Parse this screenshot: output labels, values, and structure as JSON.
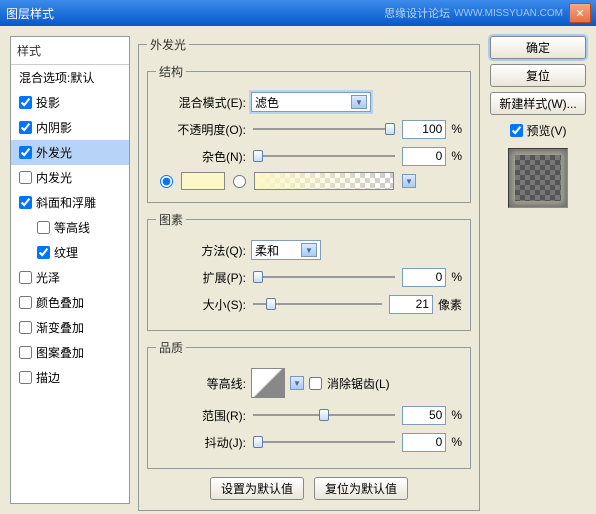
{
  "title": "图层样式",
  "brand": "思缘设计论坛",
  "url": "WWW.MISSYUAN.COM",
  "styles_title": "样式",
  "blend_options": "混合选项:默认",
  "styles": {
    "drop_shadow": "投影",
    "inner_shadow": "内阴影",
    "outer_glow": "外发光",
    "inner_glow": "内发光",
    "bevel": "斜面和浮雕",
    "contour": "等高线",
    "texture": "纹理",
    "satin": "光泽",
    "color_overlay": "颜色叠加",
    "gradient_overlay": "渐变叠加",
    "pattern_overlay": "图案叠加",
    "stroke": "描边"
  },
  "panel": {
    "title": "外发光",
    "structure": "结构",
    "blend_mode_label": "混合模式(E):",
    "blend_mode_value": "滤色",
    "opacity_label": "不透明度(O):",
    "opacity_value": "100",
    "noise_label": "杂色(N):",
    "noise_value": "0",
    "percent": "%",
    "elements": "图素",
    "technique_label": "方法(Q):",
    "technique_value": "柔和",
    "spread_label": "扩展(P):",
    "spread_value": "0",
    "size_label": "大小(S):",
    "size_value": "21",
    "px": "像素",
    "quality": "品质",
    "contour_label": "等高线:",
    "antialias_label": "消除锯齿(L)",
    "range_label": "范围(R):",
    "range_value": "50",
    "jitter_label": "抖动(J):",
    "jitter_value": "0",
    "default_btn": "设置为默认值",
    "reset_btn": "复位为默认值"
  },
  "right": {
    "ok": "确定",
    "cancel": "复位",
    "new_style": "新建样式(W)...",
    "preview": "预览(V)"
  }
}
